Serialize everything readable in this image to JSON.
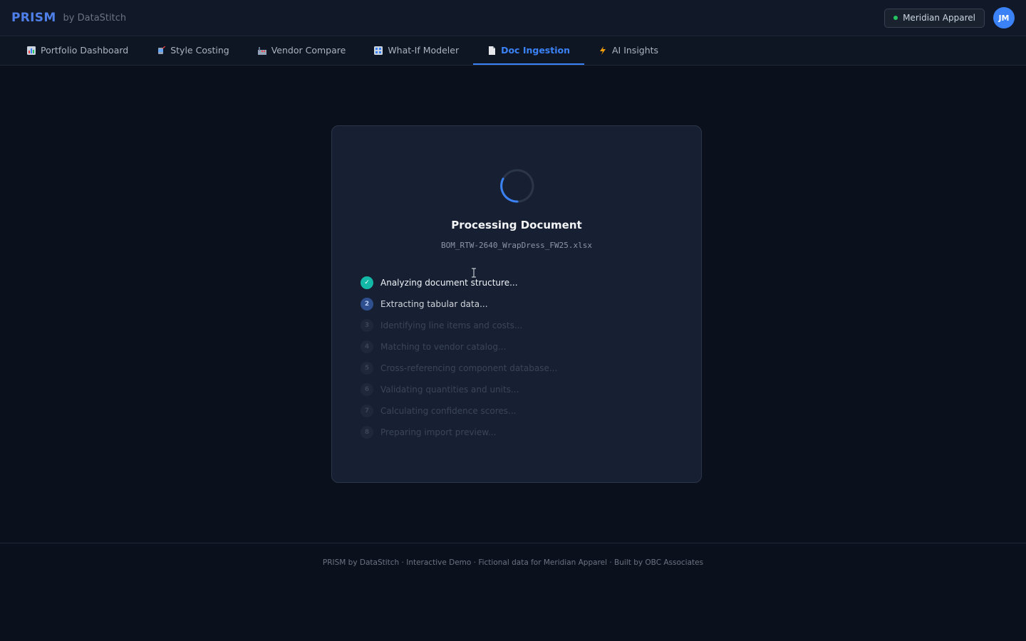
{
  "header": {
    "brand": "PRISM",
    "brand_sub": "by DataStitch",
    "org_name": "Meridian Apparel",
    "avatar_initials": "JM",
    "status_color": "#22c55e"
  },
  "nav": {
    "tabs": [
      {
        "label": "Portfolio Dashboard",
        "icon": "bar-chart-icon",
        "active": false
      },
      {
        "label": "Style Costing",
        "icon": "thread-icon",
        "active": false
      },
      {
        "label": "Vendor Compare",
        "icon": "factory-icon",
        "active": false
      },
      {
        "label": "What-If Modeler",
        "icon": "grid-icon",
        "active": false
      },
      {
        "label": "Doc Ingestion",
        "icon": "document-icon",
        "active": true
      },
      {
        "label": "AI Insights",
        "icon": "lightning-icon",
        "active": false
      }
    ],
    "accent_color": "#3b82f6"
  },
  "processing": {
    "title": "Processing Document",
    "filename": "BOM_RTW-2640_WrapDress_FW25.xlsx",
    "steps": [
      {
        "badge": "✓",
        "label": "Analyzing document structure...",
        "status": "done"
      },
      {
        "badge": "2",
        "label": "Extracting tabular data...",
        "status": "active"
      },
      {
        "badge": "3",
        "label": "Identifying line items and costs...",
        "status": "pending"
      },
      {
        "badge": "4",
        "label": "Matching to vendor catalog...",
        "status": "pending"
      },
      {
        "badge": "5",
        "label": "Cross-referencing component database...",
        "status": "pending"
      },
      {
        "badge": "6",
        "label": "Validating quantities and units...",
        "status": "pending"
      },
      {
        "badge": "7",
        "label": "Calculating confidence scores...",
        "status": "pending"
      },
      {
        "badge": "8",
        "label": "Preparing import preview...",
        "status": "pending"
      }
    ]
  },
  "footer": {
    "text": "PRISM by DataStitch · Interactive Demo · Fictional data for Meridian Apparel · Built by OBC Associates"
  }
}
